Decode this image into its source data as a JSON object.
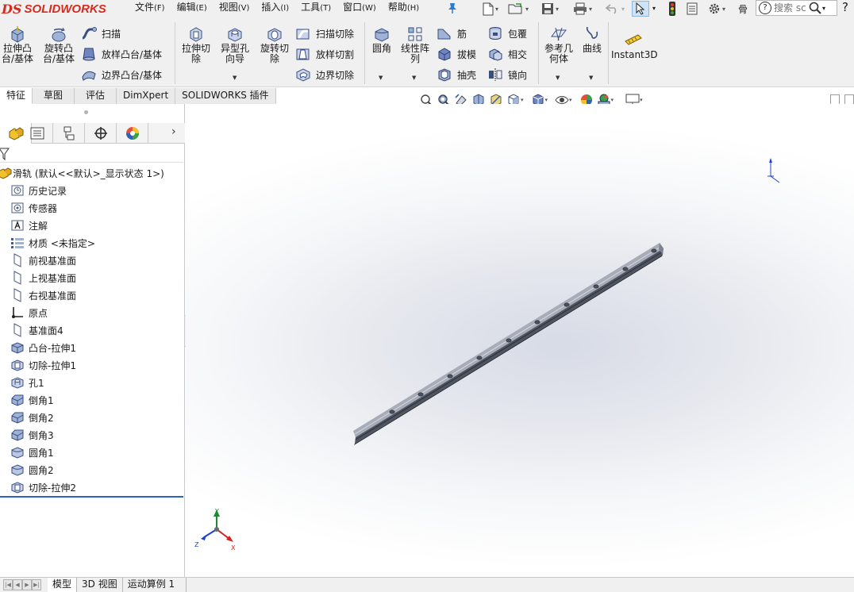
{
  "app": {
    "logo_mark": "DS",
    "logo_text": "SOLIDWORKS"
  },
  "menu": [
    {
      "label": "文件",
      "accel": "(F)"
    },
    {
      "label": "编辑",
      "accel": "(E)"
    },
    {
      "label": "视图",
      "accel": "(V)"
    },
    {
      "label": "插入",
      "accel": "(I)"
    },
    {
      "label": "工具",
      "accel": "(T)"
    },
    {
      "label": "窗口",
      "accel": "(W)"
    },
    {
      "label": "帮助",
      "accel": "(H)"
    }
  ],
  "quick_access": {
    "truncated_label": "骨",
    "search_placeholder": "搜索 sc",
    "help": "?"
  },
  "commands": {
    "extrude_boss": "拉伸凸\n台/基体",
    "revolve_boss": "旋转凸\n台/基体",
    "sweep": "扫描",
    "loft_boss": "放样凸台/基体",
    "boundary_boss": "边界凸台/基体",
    "extrude_cut": "拉伸切\n除",
    "hole_wizard": "异型孔\n向导",
    "revolve_cut": "旋转切\n除",
    "sweep_cut": "扫描切除",
    "loft_cut": "放样切割",
    "boundary_cut": "边界切除",
    "fillet": "圆角",
    "linear_pattern": "线性阵\n列",
    "rib": "筋",
    "draft": "拔模",
    "shell": "抽壳",
    "wrap": "包覆",
    "intersect": "相交",
    "mirror": "镜向",
    "ref_geometry": "参考几\n何体",
    "curves": "曲线",
    "instant3d": "Instant3D"
  },
  "tabs": [
    "特征",
    "草图",
    "评估",
    "DimXpert",
    "SOLIDWORKS 插件"
  ],
  "tree": {
    "root": "滑轨 (默认<<默认>_显示状态 1>)",
    "items": [
      {
        "icon": "history-icon",
        "label": "历史记录"
      },
      {
        "icon": "sensor-icon",
        "label": "传感器"
      },
      {
        "icon": "annotation-icon",
        "label": "注解"
      },
      {
        "icon": "material-icon",
        "label": "材质 <未指定>"
      },
      {
        "icon": "plane-icon",
        "label": "前视基准面"
      },
      {
        "icon": "plane-icon",
        "label": "上视基准面"
      },
      {
        "icon": "plane-icon",
        "label": "右视基准面"
      },
      {
        "icon": "origin-icon",
        "label": "原点"
      },
      {
        "icon": "plane-icon",
        "label": "基准面4"
      },
      {
        "icon": "boss-extrude-icon",
        "label": "凸台-拉伸1"
      },
      {
        "icon": "cut-extrude-icon",
        "label": "切除-拉伸1"
      },
      {
        "icon": "hole-icon",
        "label": "孔1"
      },
      {
        "icon": "chamfer-icon",
        "label": "倒角1"
      },
      {
        "icon": "chamfer-icon",
        "label": "倒角2"
      },
      {
        "icon": "chamfer-icon",
        "label": "倒角3"
      },
      {
        "icon": "fillet-icon",
        "label": "圆角1"
      },
      {
        "icon": "fillet-icon",
        "label": "圆角2"
      },
      {
        "icon": "cut-extrude-icon",
        "label": "切除-拉伸2"
      }
    ]
  },
  "triad": {
    "x": "X",
    "y": "Y",
    "z": "Z"
  },
  "bottom_tabs": [
    "模型",
    "3D 视图",
    "运动算例 1"
  ],
  "colors": {
    "brand": "#d52b1e",
    "accent": "#2b64b8",
    "axis_x": "#d42020",
    "axis_y": "#1f8a2f",
    "axis_z": "#1f3fd1"
  }
}
